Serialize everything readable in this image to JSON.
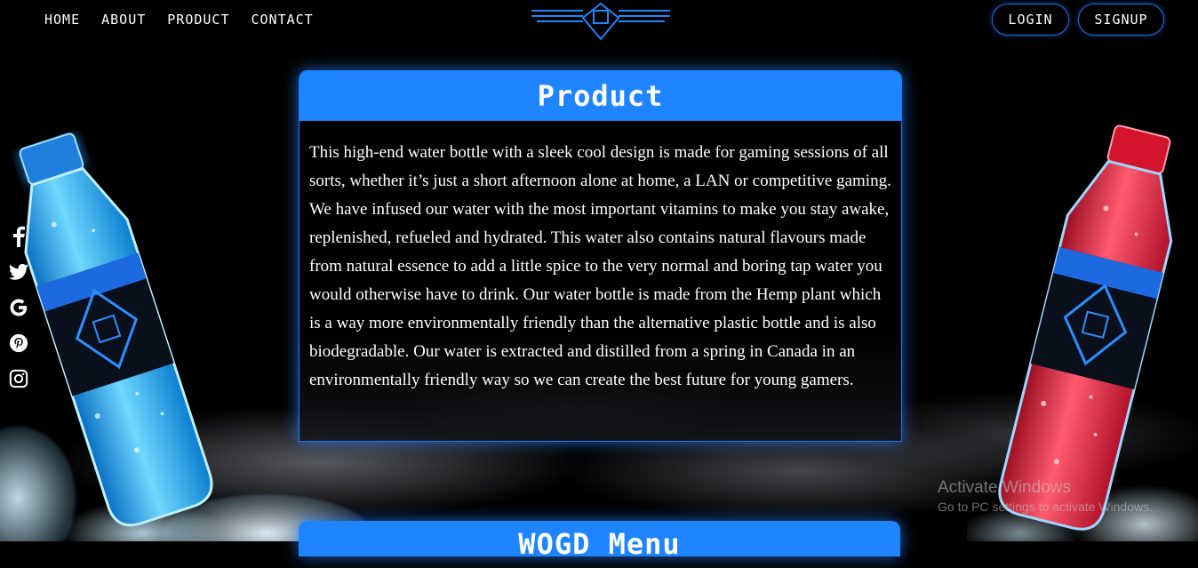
{
  "nav": {
    "items": [
      {
        "label": "HOME"
      },
      {
        "label": "ABOUT"
      },
      {
        "label": "PRODUCT"
      },
      {
        "label": "CONTACT"
      }
    ]
  },
  "auth": {
    "login_label": "LOGIN",
    "signup_label": "SIGNUP"
  },
  "social": [
    "facebook-icon",
    "twitter-icon",
    "google-icon",
    "pinterest-icon",
    "instagram-icon"
  ],
  "product": {
    "title": "Product",
    "description": "This high-end water bottle with a sleek cool design is made for gaming sessions of all sorts, whether it’s just a short afternoon alone at home, a LAN or competitive gaming. We have infused our water with the most important vitamins to make you stay awake, replenished, refueled and hydrated. This water also contains natural flavours made from natural essence to add a little spice to the very normal and boring tap water you would otherwise have to drink. Our water bottle is made from the Hemp plant which is a way more environmentally friendly than the alternative plastic bottle and is also biodegradable. Our water is extracted and distilled from a spring in Canada in an environmentally friendly way so we can create the best future for young gamers."
  },
  "next_section": {
    "title": "WOGD Menu"
  },
  "watermark": {
    "line1": "Activate Windows",
    "line2": "Go to PC settings to activate Windows."
  },
  "colors": {
    "accent": "#1e84ff",
    "background": "#000000",
    "bottle_left": "#1fa8f0",
    "bottle_right": "#e8203c"
  }
}
